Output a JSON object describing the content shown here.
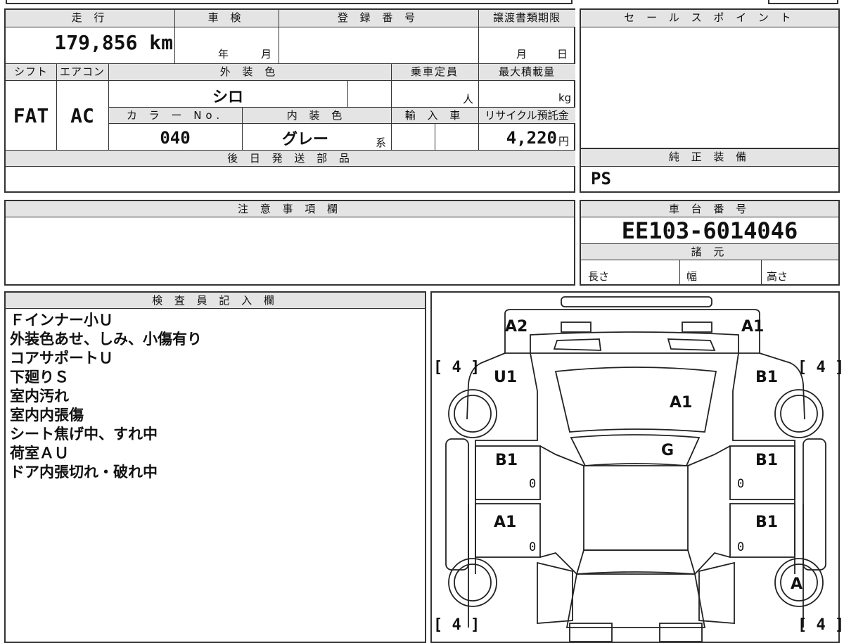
{
  "top_table": {
    "mileage_header": "走 行",
    "mileage_value": "179,856 km",
    "shaken_header": "車 検",
    "shaken_year_unit": "年",
    "shaken_month_unit": "月",
    "registration_header": "登 録 番 号",
    "registration_value": "",
    "transfer_header": "譲渡書類期限",
    "transfer_month_unit": "月",
    "transfer_day_unit": "日",
    "shift_header": "シフト",
    "shift_value": "FAT",
    "aircon_header": "エアコン",
    "aircon_value": "AC",
    "exterior_color_header": "外 装 色",
    "exterior_color_value": "シロ",
    "capacity_header": "乗車定員",
    "capacity_unit": "人",
    "max_load_header": "最大積載量",
    "max_load_unit": "kg",
    "color_no_header": "カ ラ ー No.",
    "color_no_value": "040",
    "interior_color_header": "内 装 色",
    "interior_color_value": "グレー",
    "interior_color_suffix": "系",
    "import_header": "輸 入 車",
    "recycle_header": "リサイクル預託金",
    "recycle_value": "4,220",
    "recycle_unit": "円",
    "later_parts_header": "後 日 発 送 部 品",
    "later_parts_value": ""
  },
  "sales_point": {
    "header": "セ ー ル ス ポ イ ン ト",
    "value": ""
  },
  "genuine_equipment": {
    "header": "純 正 装 備",
    "value": "PS"
  },
  "caution": {
    "header": "注 意 事 項 欄",
    "value": ""
  },
  "chassis": {
    "header": "車 台 番 号",
    "value": "EE103-6014046",
    "spec_header": "諸 元",
    "length_label": "長さ",
    "width_label": "幅",
    "height_label": "高さ"
  },
  "inspector": {
    "header": "検 査 員 記 入 欄",
    "notes": [
      "Ｆインナー小Ｕ",
      "外装色あせ、しみ、小傷有り",
      "コアサポートＵ",
      "下廻りＳ",
      "室内汚れ",
      "室内内張傷",
      "シート焦げ中、すれ中",
      "荷室ＡＵ",
      "ドア内張切れ・破れ中"
    ]
  },
  "diagram": {
    "labels": {
      "front_left": "A2",
      "front_right": "A1",
      "fender_left": "U1",
      "fender_right": "B1",
      "hood": "A1",
      "windshield": "G",
      "front_door_left": "B1",
      "front_door_right": "B1",
      "rear_door_left": "A1",
      "rear_door_right": "B1",
      "rear_wheel_right": "A"
    },
    "tire_marks": [
      "[ 4 ]",
      "[ 4 ]",
      "[ 4 ]",
      "[ 4 ]"
    ],
    "zeros": [
      "0",
      "0",
      "0",
      "0"
    ]
  }
}
